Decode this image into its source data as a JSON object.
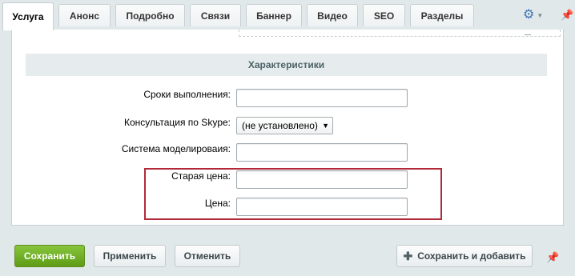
{
  "tabs": [
    {
      "label": "Услуга",
      "active": true
    },
    {
      "label": "Анонс",
      "active": false
    },
    {
      "label": "Подробно",
      "active": false
    },
    {
      "label": "Связи",
      "active": false
    },
    {
      "label": "Баннер",
      "active": false
    },
    {
      "label": "Видео",
      "active": false
    },
    {
      "label": "SEO",
      "active": false
    },
    {
      "label": "Разделы",
      "active": false
    }
  ],
  "section_title": "Характеристики",
  "fields": {
    "duration_label": "Сроки выполнения:",
    "skype_label": "Консультация по Skype:",
    "skype_value": "(не установлено)",
    "modeling_label": "Система моделироваия:",
    "old_price_label": "Старая цена:",
    "price_label": "Цена:"
  },
  "buttons": {
    "save": "Сохранить",
    "apply": "Применить",
    "cancel": "Отменить",
    "save_add": "Сохранить и добавить"
  },
  "colors": {
    "accent": "#6aa91f",
    "highlight_border": "#b22a3a",
    "gear": "#3e76b7"
  },
  "icons": {
    "settings": "gear-icon",
    "pin": "pin-icon",
    "add": "plus-icon"
  }
}
